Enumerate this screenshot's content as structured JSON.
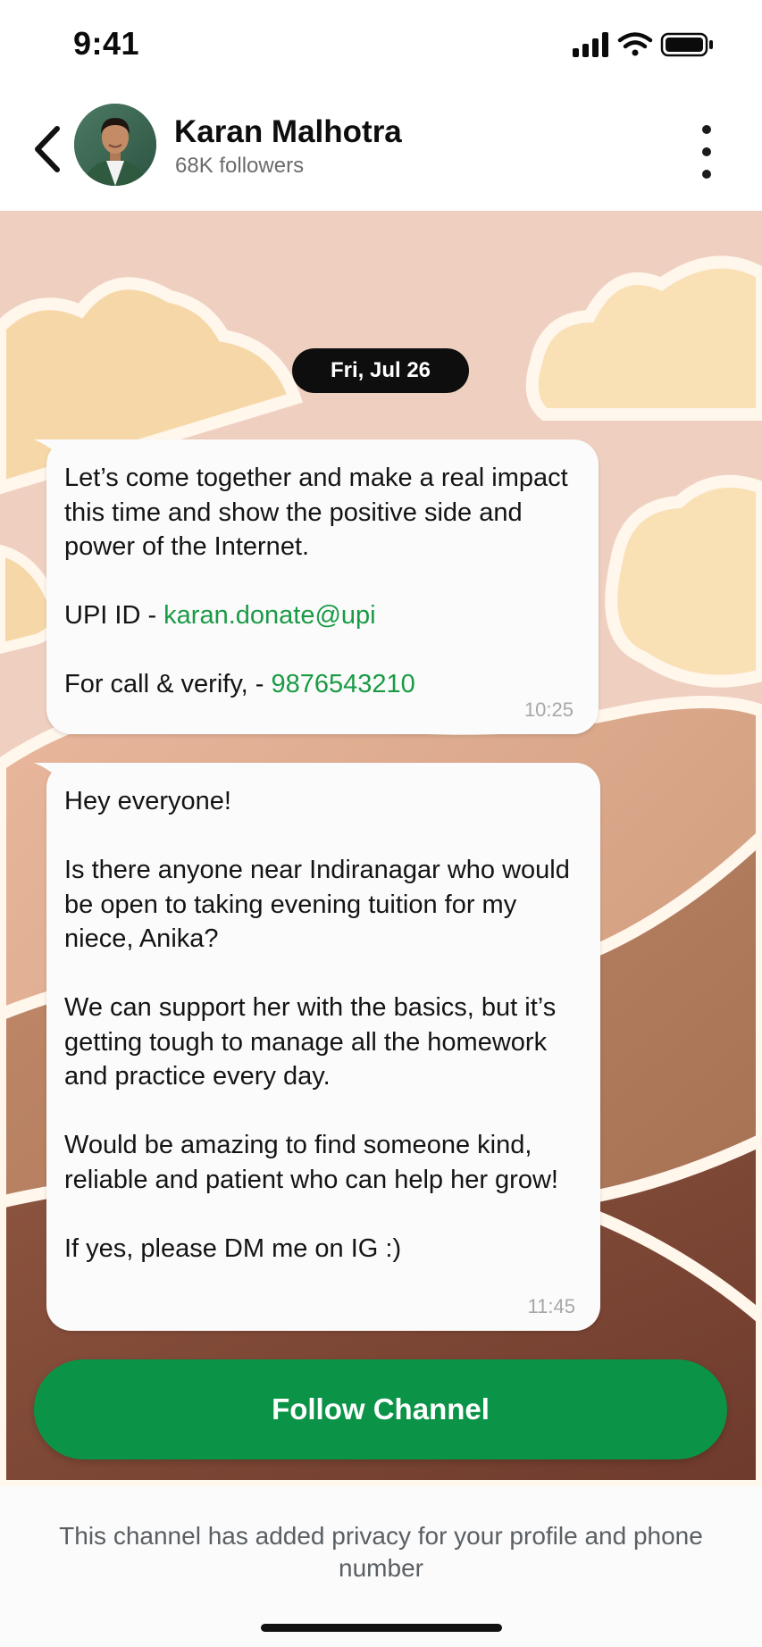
{
  "status_bar": {
    "time": "9:41"
  },
  "header": {
    "back_icon": "chevron-left-icon",
    "channel_name": "Karan Malhotra",
    "followers": "68K followers",
    "more_icon": "more-vertical-icon"
  },
  "chat": {
    "date_label": "Fri, Jul 26",
    "messages": [
      {
        "intro": "Let’s come together and make a real impact this time and show the positive side and power of the Internet.",
        "upi_label": "UPI ID - ",
        "upi_value": "karan.donate@upi",
        "call_label": "For call & verify, - ",
        "call_value": "9876543210",
        "time": "10:25"
      },
      {
        "p1": "Hey everyone!",
        "p2": "Is there anyone near Indiranagar who would be open to taking evening tuition for my niece, Anika?",
        "p3": "We can support her with the basics, but it’s getting tough to manage all the homework and practice every day.",
        "p4": "Would be amazing to find someone kind, reliable and patient who can help her grow!",
        "p5": "If yes, please DM me on IG :)",
        "time": "11:45"
      }
    ],
    "follow_label": "Follow Channel"
  },
  "footer": {
    "privacy_note": "This channel has added privacy for your profile and phone number"
  },
  "colors": {
    "accent_green": "#0b9447",
    "link_green": "#1a9a45",
    "wallpaper_base": "#efcfbf"
  }
}
